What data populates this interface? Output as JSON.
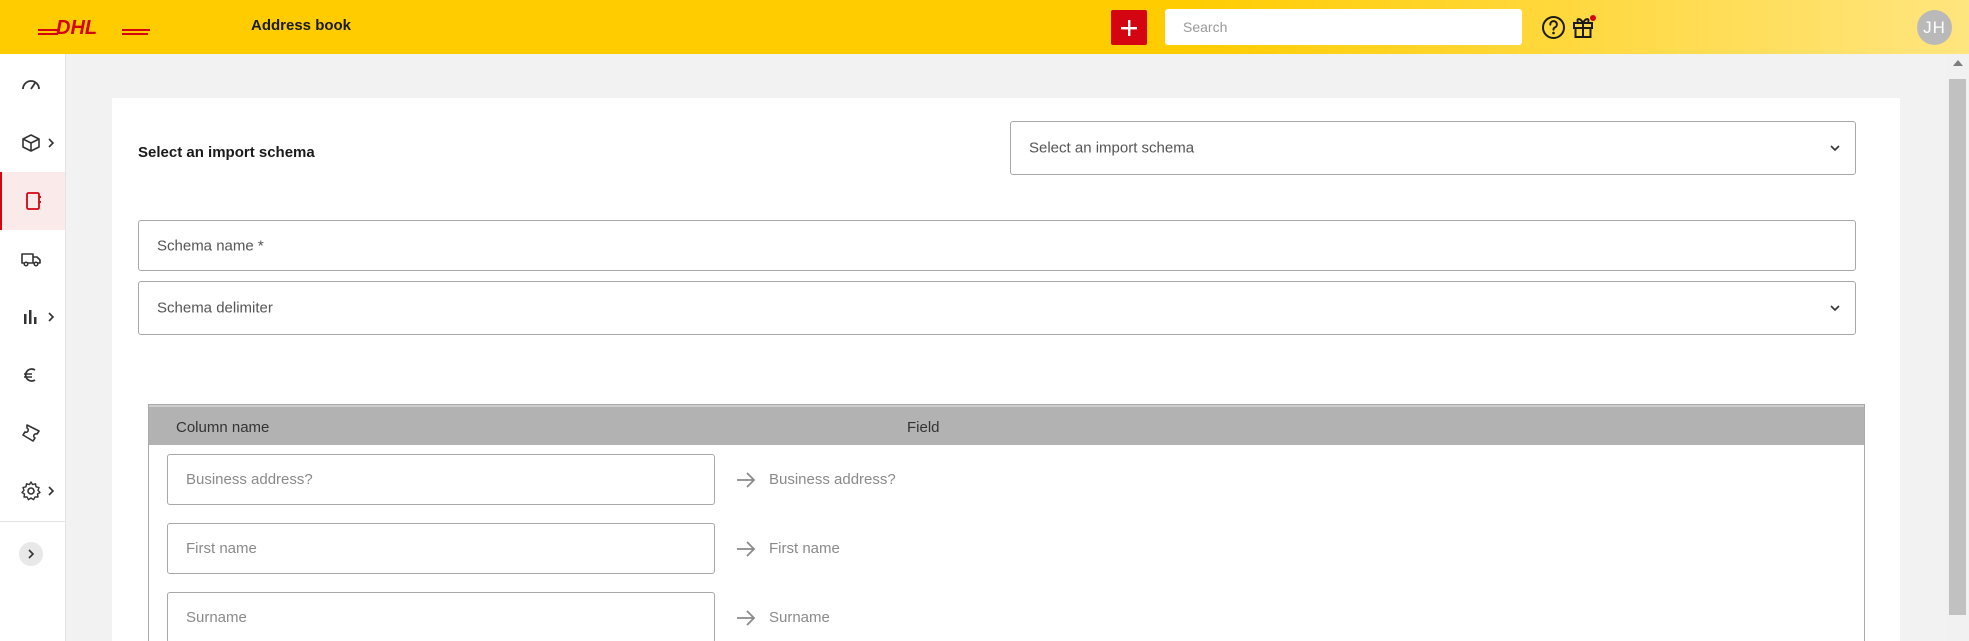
{
  "header": {
    "logo_text": "DHL",
    "title": "Address book",
    "add_icon": "plus-icon",
    "search_placeholder": "Search",
    "search_value": "",
    "help_icon": "help-circle-icon",
    "gift_icon": "gift-icon",
    "avatar_initials": "JH"
  },
  "sidebar": {
    "items": [
      {
        "icon": "dashboard-gauge-icon",
        "has_submenu": false,
        "active": false
      },
      {
        "icon": "package-box-icon",
        "has_submenu": true,
        "active": false
      },
      {
        "icon": "address-book-icon",
        "has_submenu": false,
        "active": true
      },
      {
        "icon": "truck-icon",
        "has_submenu": false,
        "active": false
      },
      {
        "icon": "bar-chart-icon",
        "has_submenu": true,
        "active": false
      },
      {
        "icon": "euro-icon",
        "has_submenu": false,
        "active": false
      },
      {
        "icon": "ticket-icon",
        "has_submenu": false,
        "active": false
      },
      {
        "icon": "gear-icon",
        "has_submenu": true,
        "active": false
      }
    ],
    "collapse_icon": "chevron-right-icon"
  },
  "form": {
    "select_schema_label": "Select an import schema",
    "select_schema_placeholder": "Select an import schema",
    "schema_name_placeholder": "Schema name *",
    "schema_delimiter_placeholder": "Schema delimiter"
  },
  "table": {
    "headers": {
      "column_name": "Column name",
      "field": "Field"
    },
    "rows": [
      {
        "column_placeholder": "Business address?",
        "field": "Business address?"
      },
      {
        "column_placeholder": "First name",
        "field": "First name"
      },
      {
        "column_placeholder": "Surname",
        "field": "Surname"
      }
    ]
  },
  "colors": {
    "brand_yellow": "#ffcc00",
    "brand_red": "#d40511",
    "table_header": "#b2b2b2"
  }
}
